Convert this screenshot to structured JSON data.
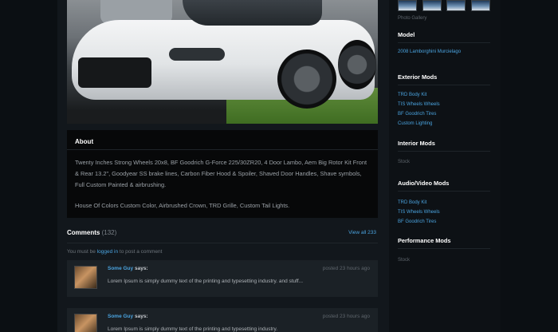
{
  "about": {
    "heading": "About",
    "paragraph1": "Twenty Inches Strong Wheels 20x8, BF Goodrich G-Force 225/30ZR20, 4 Door Lambo, Aem Big Rotor Kit Front & Rear 13.2\", Goodyear SS brake lines, Carbon Fiber Hood & Spoiler, Shaved Door Handles, Shave symbols, Full Custom Painted & airbrushing.",
    "paragraph2": "House Of Colors Custom Color, Airbrushed Crown, TRD Grille, Custom Tail Lights."
  },
  "comments": {
    "title": "Comments",
    "count": "(132)",
    "view_all": "View all 233",
    "login_prefix": "You must be",
    "login_link": "logged in",
    "login_suffix": "to post a comment",
    "items": [
      {
        "author": "Some Guy",
        "says": "says:",
        "time": "posted 23 hours ago",
        "text": "Lorem Ipsum is simply dummy text of the printing and typesetting industry. and stuff..."
      },
      {
        "author": "Some Guy",
        "says": "says:",
        "time": "posted 23 hours ago",
        "text": "Lorem Ipsum is simply dummy text of the printing and typesetting industry."
      }
    ]
  },
  "sidebar": {
    "gallery_label": "Photo Gallery",
    "model": {
      "heading": "Model",
      "value": "2008 Lamborghini Murcielago"
    },
    "exterior": {
      "heading": "Exterior Mods",
      "items": [
        "TRD Body Kit",
        "TIS Wheels Wheels",
        "BF Goodrich Tires",
        "Custom Lighting"
      ]
    },
    "interior": {
      "heading": "Interior Mods",
      "value": "Stock"
    },
    "audio": {
      "heading": "Audio/Video Mods",
      "items": [
        "TRD Body Kit",
        "TIS Wheels Wheels",
        "BF Goodrich Tires"
      ]
    },
    "performance": {
      "heading": "Performance Mods",
      "value": "Stock"
    }
  },
  "colors": {
    "accent_link": "#4aa3df",
    "background": "#0b0f13",
    "panel": "#12171c",
    "comment_bg": "#1b2126"
  }
}
